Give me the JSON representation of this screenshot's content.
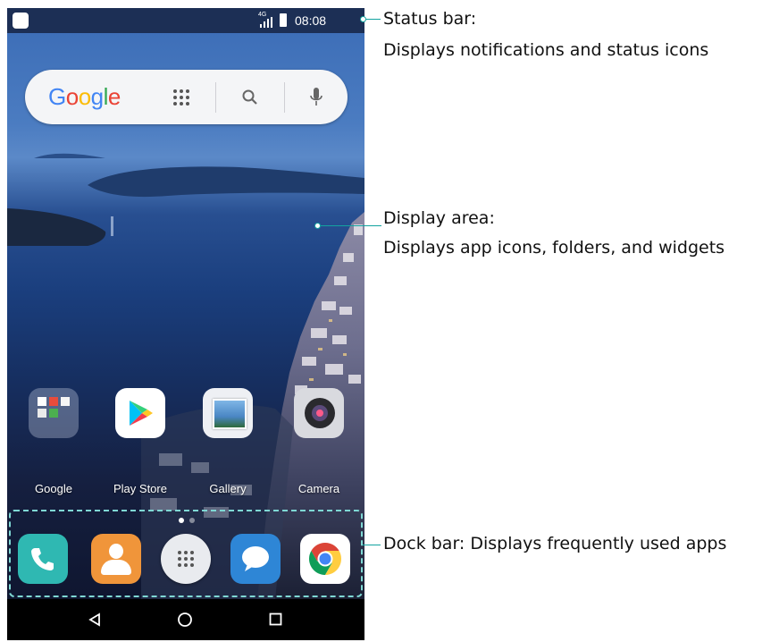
{
  "status_bar": {
    "time": "08:08",
    "network": "4G",
    "icons": [
      "notification-icon",
      "signal-icon",
      "battery-icon"
    ]
  },
  "search_widget": {
    "brand": "Google",
    "icons": [
      "apps-grid-icon",
      "search-icon",
      "microphone-icon"
    ]
  },
  "home_apps": [
    {
      "label": "Google",
      "icon": "folder-icon"
    },
    {
      "label": "Play Store",
      "icon": "play-store-icon"
    },
    {
      "label": "Gallery",
      "icon": "gallery-icon"
    },
    {
      "label": "Camera",
      "icon": "camera-icon"
    }
  ],
  "page_indicator": {
    "pages": 2,
    "current": 1
  },
  "dock": [
    {
      "name": "Phone",
      "icon": "phone-icon"
    },
    {
      "name": "Contacts",
      "icon": "contacts-icon"
    },
    {
      "name": "Apps",
      "icon": "app-drawer-icon"
    },
    {
      "name": "Messages",
      "icon": "messages-icon"
    },
    {
      "name": "Chrome",
      "icon": "chrome-icon"
    }
  ],
  "nav_bar": {
    "icons": [
      "back-icon",
      "home-icon",
      "recents-icon"
    ]
  },
  "annotations": {
    "status_title": "Status bar:",
    "status_desc": "Displays notifications and status icons",
    "display_title": "Display area:",
    "display_desc": "Displays app icons, folders, and widgets",
    "dock_text": "Dock bar: Displays frequently used apps"
  },
  "colors": {
    "annotation": "#13a3a0",
    "status_bar": "#1c2f55",
    "dock_border": "#7fd8d4"
  }
}
